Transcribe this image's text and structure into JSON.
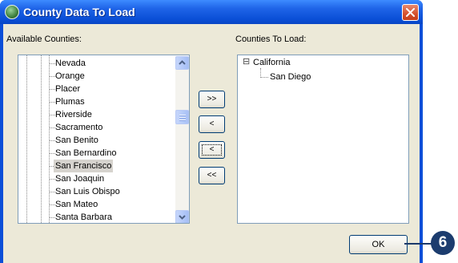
{
  "window": {
    "title": "County Data To Load"
  },
  "available": {
    "label": "Available Counties:",
    "items": [
      "Nevada",
      "Orange",
      "Placer",
      "Plumas",
      "Riverside",
      "Sacramento",
      "San Benito",
      "San Bernardino",
      "San Francisco",
      "San Joaquin",
      "San Luis Obispo",
      "San Mateo",
      "Santa Barbara"
    ],
    "selected": "San Francisco"
  },
  "to_load": {
    "label": "Counties To Load:",
    "root": "California",
    "root_toggle": "⊟",
    "children": [
      "San Diego"
    ]
  },
  "buttons": {
    "add_all": ">>",
    "add": "<",
    "remove": "<",
    "remove_all": "<<",
    "ok": "OK"
  },
  "callout": {
    "number": "6"
  },
  "colors": {
    "titlebar": "#0a4fd6",
    "callout": "#1c3c6e",
    "selection": "#d6d3ce"
  }
}
